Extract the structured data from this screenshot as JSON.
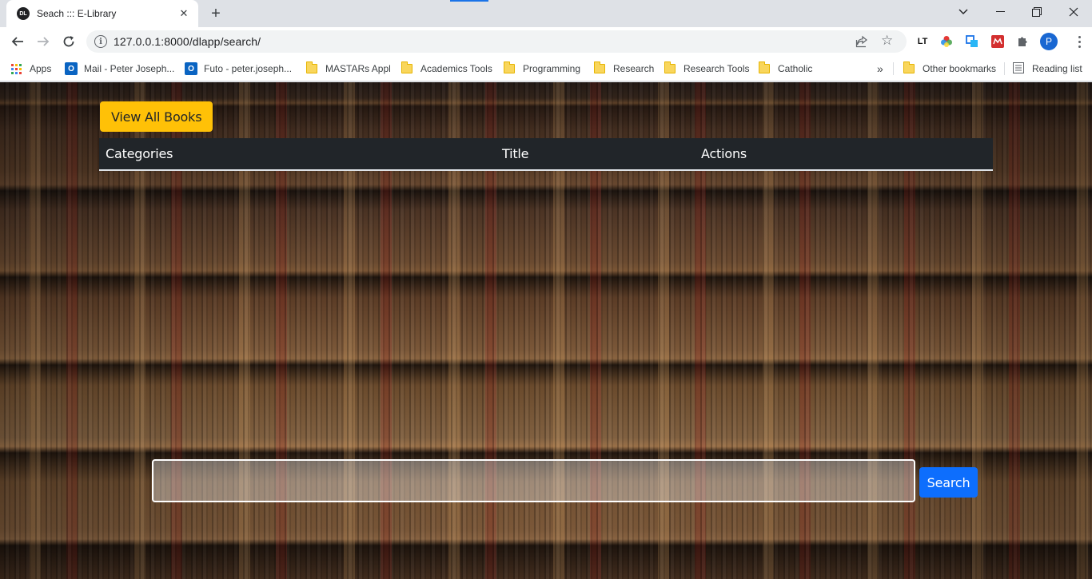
{
  "browser": {
    "tab": {
      "title": "Seach ::: E-Library",
      "favicon": "site-favicon"
    },
    "new_tab": "+",
    "address": {
      "url": "127.0.0.1:8000/dlapp/search/"
    },
    "profile_initial": "P",
    "extensions": [
      "lt-extension-icon",
      "color-wheel-extension-icon",
      "screen-capture-extension-icon",
      "mendeley-extension-icon",
      "puzzle-extensions-icon"
    ],
    "bookmarks": [
      {
        "label": "Apps",
        "icon": "apps-grid-icon"
      },
      {
        "label": "Mail - Peter Joseph...",
        "icon": "outlook-icon"
      },
      {
        "label": "Futo - peter.joseph...",
        "icon": "outlook-icon"
      },
      {
        "label": "MASTARs Appl",
        "icon": "folder-icon"
      },
      {
        "label": "Academics Tools",
        "icon": "folder-icon"
      },
      {
        "label": "Programming",
        "icon": "folder-icon"
      },
      {
        "label": "Research",
        "icon": "folder-icon"
      },
      {
        "label": "Research Tools",
        "icon": "folder-icon"
      },
      {
        "label": "Catholic",
        "icon": "folder-icon"
      }
    ],
    "bookmarks_overflow": "»",
    "other_bookmarks": "Other bookmarks",
    "reading_list": "Reading list"
  },
  "page": {
    "view_all_label": "View All Books",
    "table": {
      "headers": [
        "Categories",
        "Title",
        "Actions"
      ]
    },
    "search": {
      "placeholder": "",
      "value": "",
      "button_label": "Search"
    }
  },
  "colors": {
    "warning": "#ffc107",
    "primary": "#0d6efd",
    "table_header": "#212529"
  }
}
